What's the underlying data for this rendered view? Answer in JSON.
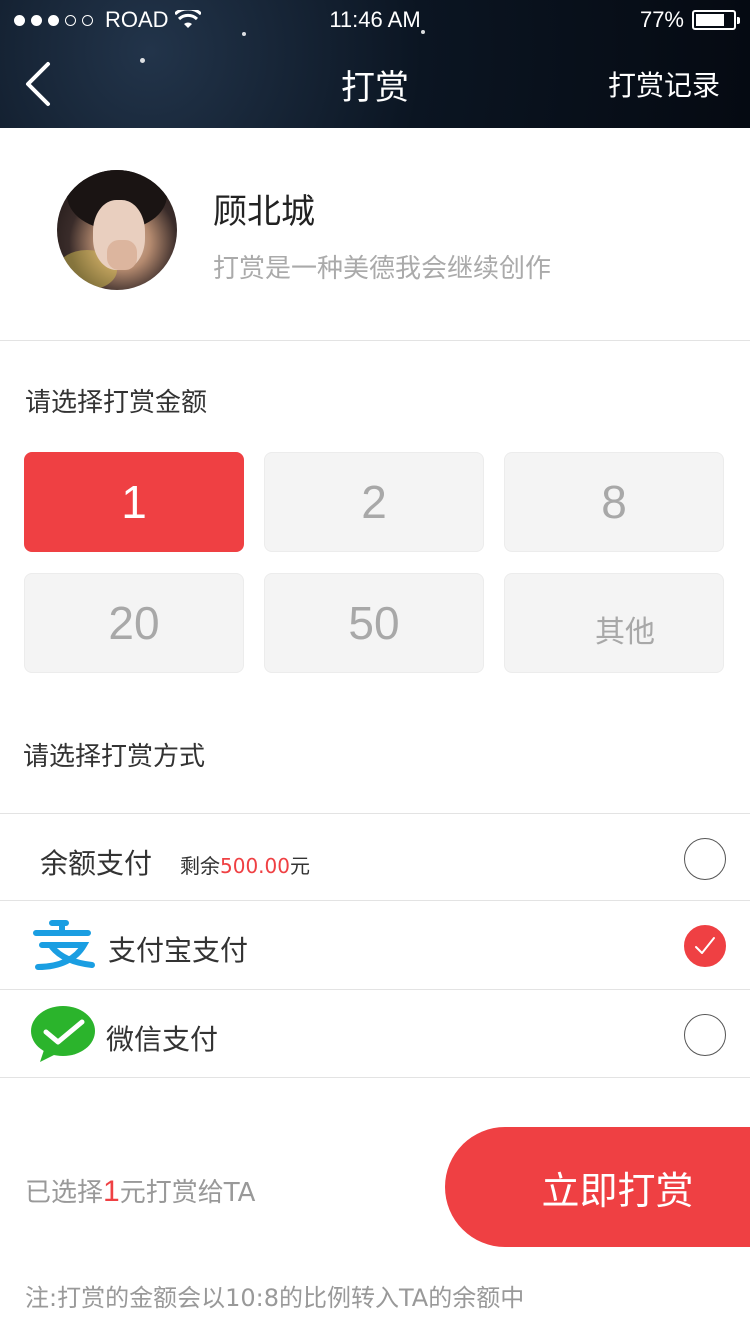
{
  "status_bar": {
    "carrier": "ROAD",
    "time": "11:46 AM",
    "battery": "77%",
    "battery_level": 0.77
  },
  "nav": {
    "back_icon": "chevron-left-icon",
    "title": "打赏",
    "right_label": "打赏记录"
  },
  "profile": {
    "name": "顾北城",
    "description": "打赏是一种美德我会继续创作"
  },
  "amount_section": {
    "title": "请选择打赏金额",
    "options": [
      "1",
      "2",
      "8",
      "20",
      "50",
      "其他"
    ],
    "selected": "1"
  },
  "payment_section": {
    "title": "请选择打赏方式",
    "methods": [
      {
        "label": "余额支付",
        "sub_prefix": "剩余",
        "sub_amount": "500.00",
        "sub_suffix": "元",
        "checked": false
      },
      {
        "label": "支付宝支付",
        "icon": "alipay-icon",
        "checked": true
      },
      {
        "label": "微信支付",
        "icon": "wechat-icon",
        "checked": false
      }
    ]
  },
  "footer": {
    "summary_prefix": "已选择",
    "summary_amount": "1",
    "summary_suffix": "元打赏给TA",
    "submit_label": "立即打赏",
    "note": "注:打赏的金额会以10:8的比例转入TA的余额中"
  },
  "colors": {
    "accent": "#ef4043",
    "tile_bg": "#f4f4f4",
    "alipay": "#1a9ee2",
    "wechat": "#2bb42c"
  }
}
